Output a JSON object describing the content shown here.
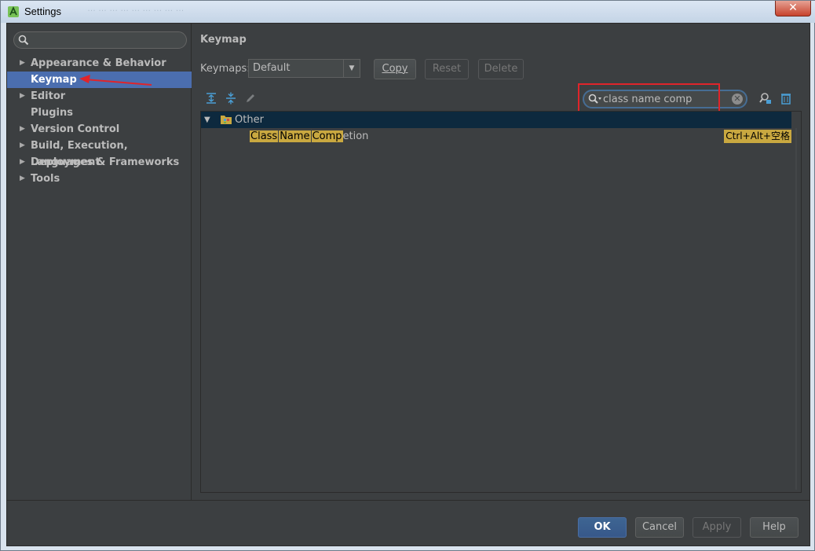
{
  "window": {
    "title": "Settings",
    "blurred_title_bar": "…  …  …  …  …  …  …  …  …"
  },
  "sidebar": {
    "search_placeholder": "",
    "items": [
      {
        "label": "Appearance & Behavior",
        "expandable": true
      },
      {
        "label": "Keymap",
        "expandable": false,
        "selected": true
      },
      {
        "label": "Editor",
        "expandable": true
      },
      {
        "label": "Plugins",
        "expandable": false
      },
      {
        "label": "Version Control",
        "expandable": true
      },
      {
        "label": "Build, Execution, Deployment",
        "expandable": true
      },
      {
        "label": "Languages & Frameworks",
        "expandable": true
      },
      {
        "label": "Tools",
        "expandable": true
      }
    ]
  },
  "main": {
    "title": "Keymap",
    "keymaps_label": "Keymaps:",
    "keymap_value": "Default",
    "copy_label": "Copy",
    "reset_label": "Reset",
    "delete_label": "Delete",
    "search_value": "class name comp"
  },
  "tree": {
    "group_label": "Other",
    "action": {
      "highlighted_parts": [
        "Class",
        "Name",
        "Comp"
      ],
      "rest": "etion",
      "shortcut": "Ctrl+Alt+空格"
    }
  },
  "footer": {
    "ok_label": "OK",
    "cancel_label": "Cancel",
    "apply_label": "Apply",
    "help_label": "Help"
  },
  "colors": {
    "selection": "#4b6eaf",
    "match_highlight": "#c9a840",
    "annotation_red": "#e0242a"
  },
  "icons": [
    "android-studio-icon",
    "search-icon",
    "expand-all-icon",
    "collapse-all-icon",
    "edit-icon",
    "find-shortcut-icon",
    "clear-filter-icon",
    "folder-icon",
    "close-icon"
  ]
}
